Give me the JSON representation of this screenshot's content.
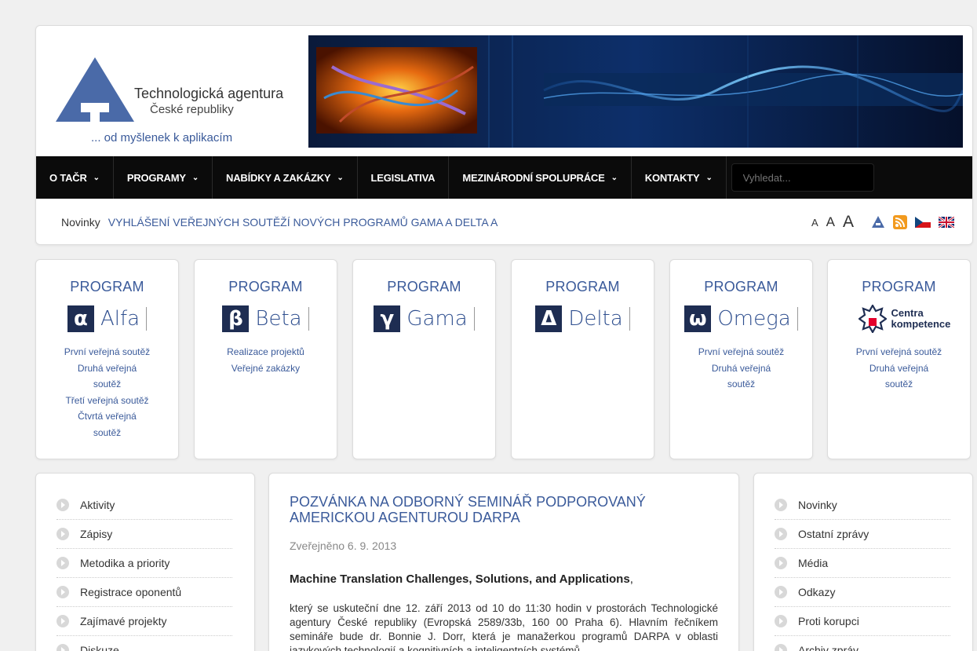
{
  "header": {
    "org_name": "Technologická agentura",
    "org_sub": "České republiky",
    "tagline": "... od myšlenek k aplikacím"
  },
  "nav": {
    "items": [
      {
        "label": "O TAČR",
        "has_menu": true
      },
      {
        "label": "PROGRAMY",
        "has_menu": true
      },
      {
        "label": "NABÍDKY A ZAKÁZKY",
        "has_menu": true
      },
      {
        "label": "LEGISLATIVA",
        "has_menu": false
      },
      {
        "label": "MEZINÁRODNÍ SPOLUPRÁCE",
        "has_menu": true
      },
      {
        "label": "KONTAKTY",
        "has_menu": true
      }
    ],
    "search_placeholder": "Vyhledat..."
  },
  "newsbar": {
    "label": "Novinky",
    "headline": "VYHLÁŠENÍ VEŘEJNÝCH SOUTĚŽÍ NOVÝCH PROGRAMŮ GAMA A DELTA A",
    "font_sizes": [
      "A",
      "A",
      "A"
    ]
  },
  "programs": [
    {
      "title": "PROGRAM",
      "symbol": "α",
      "name": "Alfa",
      "links": [
        "První veřejná soutěž",
        "Druhá veřejná soutěž",
        "Třetí veřejná soutěž",
        "Čtvrtá veřejná soutěž"
      ]
    },
    {
      "title": "PROGRAM",
      "symbol": "β",
      "name": "Beta",
      "links": [
        "Realizace projektů",
        "Veřejné zakázky"
      ]
    },
    {
      "title": "PROGRAM",
      "symbol": "γ",
      "name": "Gama",
      "links": []
    },
    {
      "title": "PROGRAM",
      "symbol": "Δ",
      "name": "Delta",
      "links": []
    },
    {
      "title": "PROGRAM",
      "symbol": "ω",
      "name": "Omega",
      "links": [
        "První veřejná soutěž",
        "Druhá veřejná soutěž"
      ]
    },
    {
      "title": "PROGRAM",
      "symbol": "",
      "name": "Centra kompetence",
      "links": [
        "První veřejná soutěž",
        "Druhá veřejná soutěž"
      ]
    }
  ],
  "left_nav": [
    "Aktivity",
    "Zápisy",
    "Metodika a priority",
    "Registrace oponentů",
    "Zajímavé projekty",
    "Diskuze"
  ],
  "right_nav": [
    "Novinky",
    "Ostatní zprávy",
    "Média",
    "Odkazy",
    "Proti korupci",
    "Archiv zpráv"
  ],
  "article": {
    "title": "POZVÁNKA NA ODBORNÝ SEMINÁŘ PODPOROVANÝ AMERICKOU AGENTUROU DARPA",
    "date": "Zveřejněno 6. 9. 2013",
    "bold_title": "Machine Translation Challenges, Solutions, and Applications",
    "bold_suffix": ",",
    "body": "který se uskuteční dne 12. září 2013 od 10 do 11:30 hodin v prostorách Technologické agentury České republiky (Evropská 2589/33b, 160 00 Praha 6). Hlavním řečníkem semináře bude dr. Bonnie J. Dorr, která je manažerkou programů DARPA v oblasti jazykových technologií a kognitivních a inteligentních systémů."
  },
  "colors": {
    "accent": "#3a5a9a",
    "nav_bg": "#0b0b0b",
    "program_symbol_bg": "#1e2d52"
  }
}
